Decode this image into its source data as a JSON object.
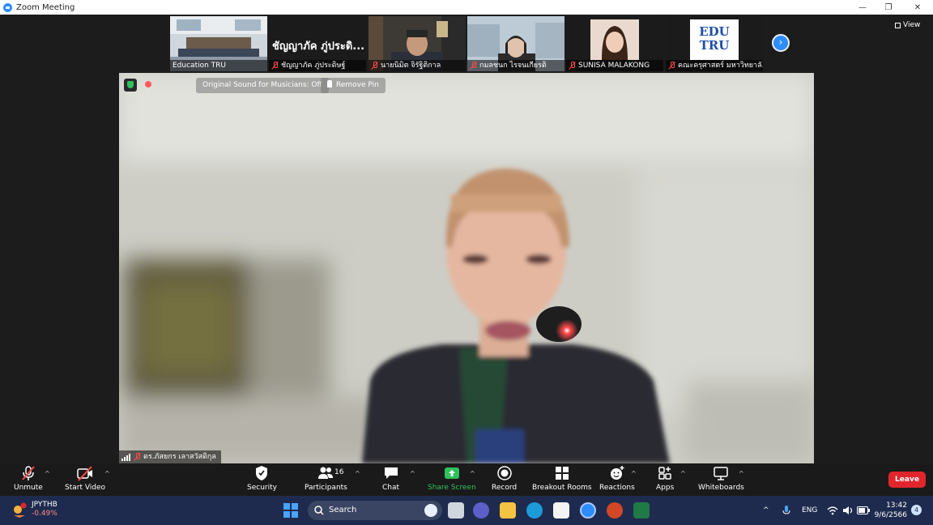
{
  "window": {
    "title": "Zoom Meeting",
    "controls": [
      "—",
      "❐",
      "✕"
    ]
  },
  "thumbnails": [
    {
      "name": "Education TRU",
      "muted": false,
      "banner": ""
    },
    {
      "name": "ชัญญาภัค ภู่ประดิษฐ์",
      "muted": true,
      "banner": "ชัญญาภัค ภู่ประดิ..."
    },
    {
      "name": "นายนิมิต จิรัฐิติกาล",
      "muted": true,
      "banner": ""
    },
    {
      "name": "กมลชนก ไรจนเกียรติ",
      "muted": true,
      "banner": ""
    },
    {
      "name": "SUNISA MALAKONG",
      "muted": true,
      "banner": ""
    },
    {
      "name": "คณะครุศาสตร์ มหาวิทยาลั...",
      "muted": true,
      "banner": "EDU TRU"
    }
  ],
  "view_label": "View",
  "main_video": {
    "recording_label": "Recording",
    "original_sound_label": "Original Sound for Musicians: Off",
    "remove_pin_label": "Remove Pin",
    "speaker_name": "ดร.ภัสยกร เลาสวัสดิกุล"
  },
  "toolbar": {
    "unmute": "Unmute",
    "start_video": "Start Video",
    "security": "Security",
    "participants": "Participants",
    "participants_count": "16",
    "chat": "Chat",
    "share_screen": "Share Screen",
    "record": "Record",
    "breakout_rooms": "Breakout Rooms",
    "reactions": "Reactions",
    "apps": "Apps",
    "whiteboards": "Whiteboards",
    "leave": "Leave"
  },
  "taskbar": {
    "ticker_symbol": "JPYTHB",
    "ticker_change": "-0.49%",
    "search_label": "Search",
    "language": "ENG",
    "time": "13:42",
    "date": "9/6/2566",
    "notification_count": "4"
  },
  "colors": {
    "accent": "#2d8cff",
    "share_green": "#2fc15c",
    "leave_red": "#e0262c",
    "muted_red": "#ff4a4a"
  }
}
